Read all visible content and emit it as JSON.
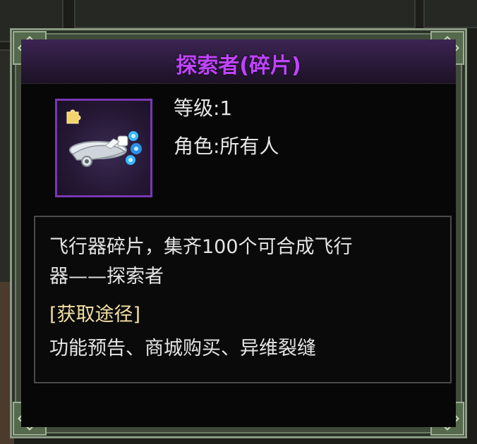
{
  "tooltip": {
    "title": "探索者(碎片)",
    "item_icon": "aircraft-fragment-icon",
    "level": "等级:1",
    "role": "角色:所有人",
    "description_line1": "飞行器碎片，集齐100个可合成飞行",
    "description_line2": "器——探索者",
    "acquire_header": "[获取途径]",
    "acquire_sources": "功能预告、商城购买、异维裂缝"
  },
  "colors": {
    "title": "#c044ff",
    "acquire_header": "#f2dea2",
    "icon_border": "#7a37b3"
  }
}
